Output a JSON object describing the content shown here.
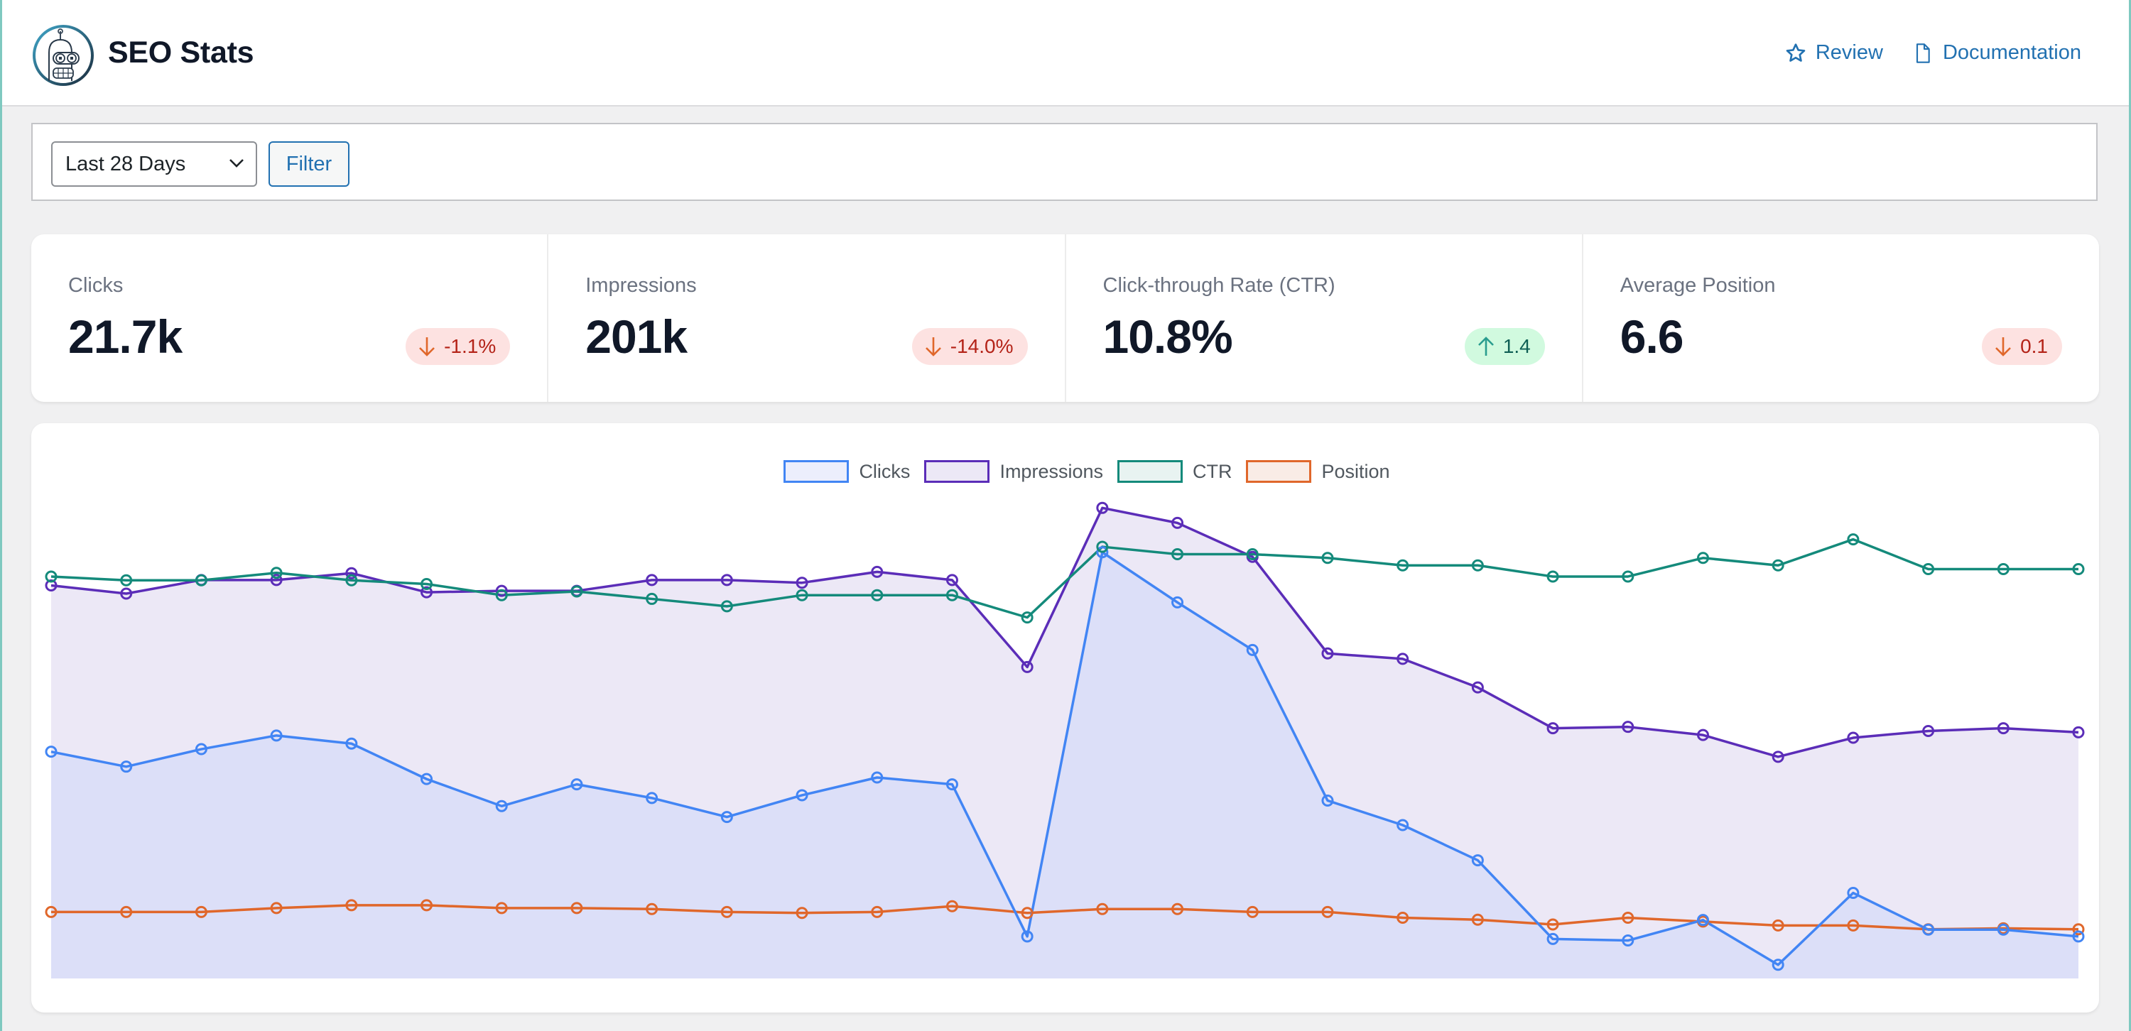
{
  "header": {
    "title": "SEO Stats",
    "logo_icon": "robot-logo-icon",
    "links": [
      {
        "label": "Review",
        "icon": "star-icon"
      },
      {
        "label": "Documentation",
        "icon": "document-icon"
      }
    ]
  },
  "filter": {
    "range_select": {
      "selected": "Last 28 Days",
      "icon": "chevron-down-icon"
    },
    "filter_button": "Filter"
  },
  "stats": [
    {
      "label": "Clicks",
      "value": "21.7k",
      "change": "-1.1%",
      "direction": "down"
    },
    {
      "label": "Impressions",
      "value": "201k",
      "change": "-14.0%",
      "direction": "down"
    },
    {
      "label": "Click-through Rate (CTR)",
      "value": "10.8%",
      "change": "1.4",
      "direction": "up"
    },
    {
      "label": "Average Position",
      "value": "6.6",
      "change": "0.1",
      "direction": "down"
    }
  ],
  "colors": {
    "link": "#2271b1",
    "badge_down_bg": "#fde2e1",
    "badge_down_text": "#b42318",
    "badge_down_arrow": "#e0672b",
    "badge_up_bg": "#d1fadf",
    "badge_up_text": "#0f5f55",
    "badge_up_arrow": "#2a9d8f"
  },
  "chart_data": {
    "type": "line",
    "title": "",
    "xlabel": "",
    "ylabel": "",
    "grid": false,
    "legend_position": "top-center",
    "x_count": 28,
    "x_labels_visible": false,
    "series": [
      {
        "name": "Clicks",
        "color": "#4285f4",
        "fill": "#dcdff8",
        "legend_fill": "#eceefc",
        "filled": true,
        "ylim": [
          0,
          2390
        ],
        "values": [
          1063,
          993,
          1075,
          1139,
          1101,
          935,
          808,
          910,
          846,
          757,
          859,
          942,
          910,
          197,
          1998,
          1763,
          1540,
          834,
          719,
          554,
          185,
          178,
          274,
          64,
          401,
          229,
          229,
          197
        ]
      },
      {
        "name": "Impressions",
        "color": "#5b2db8",
        "fill": "#ece8f6",
        "legend_fill": "#ece8f6",
        "filled": true,
        "ylim": [
          0,
          10580
        ],
        "values": [
          8156,
          7987,
          8269,
          8269,
          8410,
          8015,
          8043,
          8043,
          8269,
          8269,
          8212,
          8438,
          8269,
          6463,
          9765,
          9454,
          8749,
          6745,
          6632,
          6039,
          5193,
          5221,
          5052,
          4600,
          4995,
          5136,
          5193,
          5108
        ]
      },
      {
        "name": "CTR",
        "color": "#148a7b",
        "fill": "none",
        "legend_fill": "#e8f3f1",
        "filled": false,
        "ylim": [
          0,
          13.7
        ],
        "values": [
          10.8,
          10.7,
          10.7,
          10.9,
          10.7,
          10.6,
          10.3,
          10.4,
          10.2,
          10.0,
          10.3,
          10.3,
          10.3,
          9.7,
          11.6,
          11.4,
          11.4,
          11.3,
          11.1,
          11.1,
          10.8,
          10.8,
          11.3,
          11.1,
          11.8,
          11.0,
          11.0,
          11.0
        ]
      },
      {
        "name": "Position",
        "color": "#e0672b",
        "fill": "none",
        "legend_fill": "#f9ece6",
        "filled": false,
        "ylim": [
          0,
          52.9
        ],
        "values": [
          6.9,
          6.9,
          6.9,
          7.3,
          7.6,
          7.6,
          7.3,
          7.3,
          7.2,
          6.9,
          6.8,
          6.9,
          7.5,
          6.8,
          7.2,
          7.2,
          6.9,
          6.9,
          6.3,
          6.1,
          5.6,
          6.3,
          5.9,
          5.5,
          5.5,
          5.1,
          5.2,
          5.1
        ]
      }
    ]
  }
}
